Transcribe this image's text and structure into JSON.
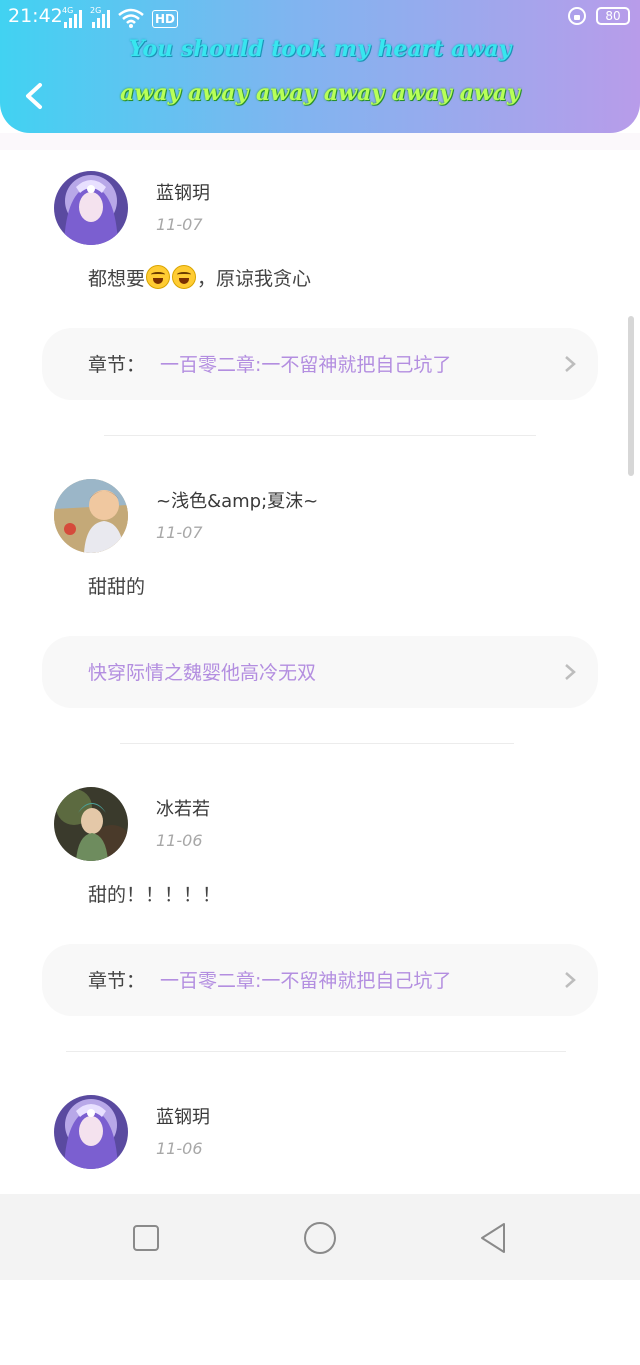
{
  "status_bar": {
    "time": "21:42",
    "network_1": "4G",
    "network_2": "2G",
    "hd_label": "HD",
    "battery": "80"
  },
  "header": {
    "lyric_line_1": "You should took my heart away",
    "lyric_line_2": "away away away away away away",
    "back_icon": "chevron-left-icon",
    "gradient_start": "#41d2f2",
    "gradient_end": "#b89cea"
  },
  "comments": [
    {
      "username": "蓝钢玥",
      "date": "11-07",
      "text_before_emoji": "都想要",
      "emoji": "tears-of-joy-emoji",
      "text_after_emoji": "，原谅我贪心",
      "chapter_label": "章节：",
      "chapter_title": "一百零二章:一不留神就把自己坑了"
    },
    {
      "username": "~浅色&amp;夏沫~",
      "date": "11-07",
      "text": "甜甜的",
      "chapter_label": "",
      "chapter_title": "快穿际情之魏婴他高冷无双"
    },
    {
      "username": "冰若若",
      "date": "11-06",
      "text": "甜的！！！！！",
      "chapter_label": "章节：",
      "chapter_title": "一百零二章:一不留神就把自己坑了"
    },
    {
      "username": "蓝钢玥",
      "date": "11-06"
    }
  ],
  "colors": {
    "chapter_title": "#b38ee0",
    "chapter_card_bg": "#f8f8f8"
  },
  "nav_bar": {
    "recents_icon": "square-icon",
    "home_icon": "circle-icon",
    "back_icon": "triangle-back-icon"
  }
}
